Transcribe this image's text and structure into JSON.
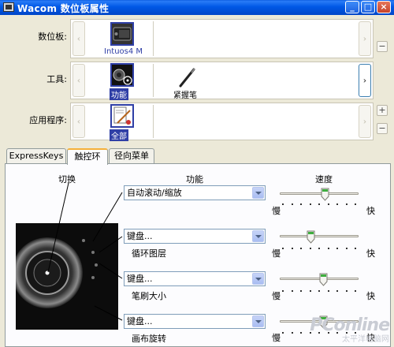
{
  "window": {
    "title": "Wacom 数位板属性",
    "minimize": "_",
    "maximize": "□",
    "close": "×"
  },
  "rows": {
    "tablet": {
      "label": "数位板:",
      "item": "Intuos4 M"
    },
    "tool": {
      "label": "工具:",
      "items": [
        "功能",
        "紧握笔"
      ]
    },
    "app": {
      "label": "应用程序:",
      "item": "全部"
    }
  },
  "buttons": {
    "arrow_left": "‹",
    "arrow_right": "›",
    "minus": "−",
    "plus": "+"
  },
  "tabs": [
    "ExpressKeys",
    "触控环",
    "径向菜单"
  ],
  "active_tab": 1,
  "panel": {
    "toggle_label": "切换",
    "function_header": "功能",
    "speed_header": "速度",
    "slow": "慢",
    "fast": "快",
    "modes": [
      {
        "function": "自动滚动/缩放",
        "sublabel": "",
        "speed": 0.58
      },
      {
        "function": "键盘...",
        "sublabel": "循环图层",
        "speed": 0.38
      },
      {
        "function": "键盘...",
        "sublabel": "笔刷大小",
        "speed": 0.56
      },
      {
        "function": "键盘...",
        "sublabel": "画布旋转",
        "speed": 0.56
      }
    ]
  },
  "watermark": {
    "line1": "PConline",
    "line2": "太平洋电脑网"
  }
}
